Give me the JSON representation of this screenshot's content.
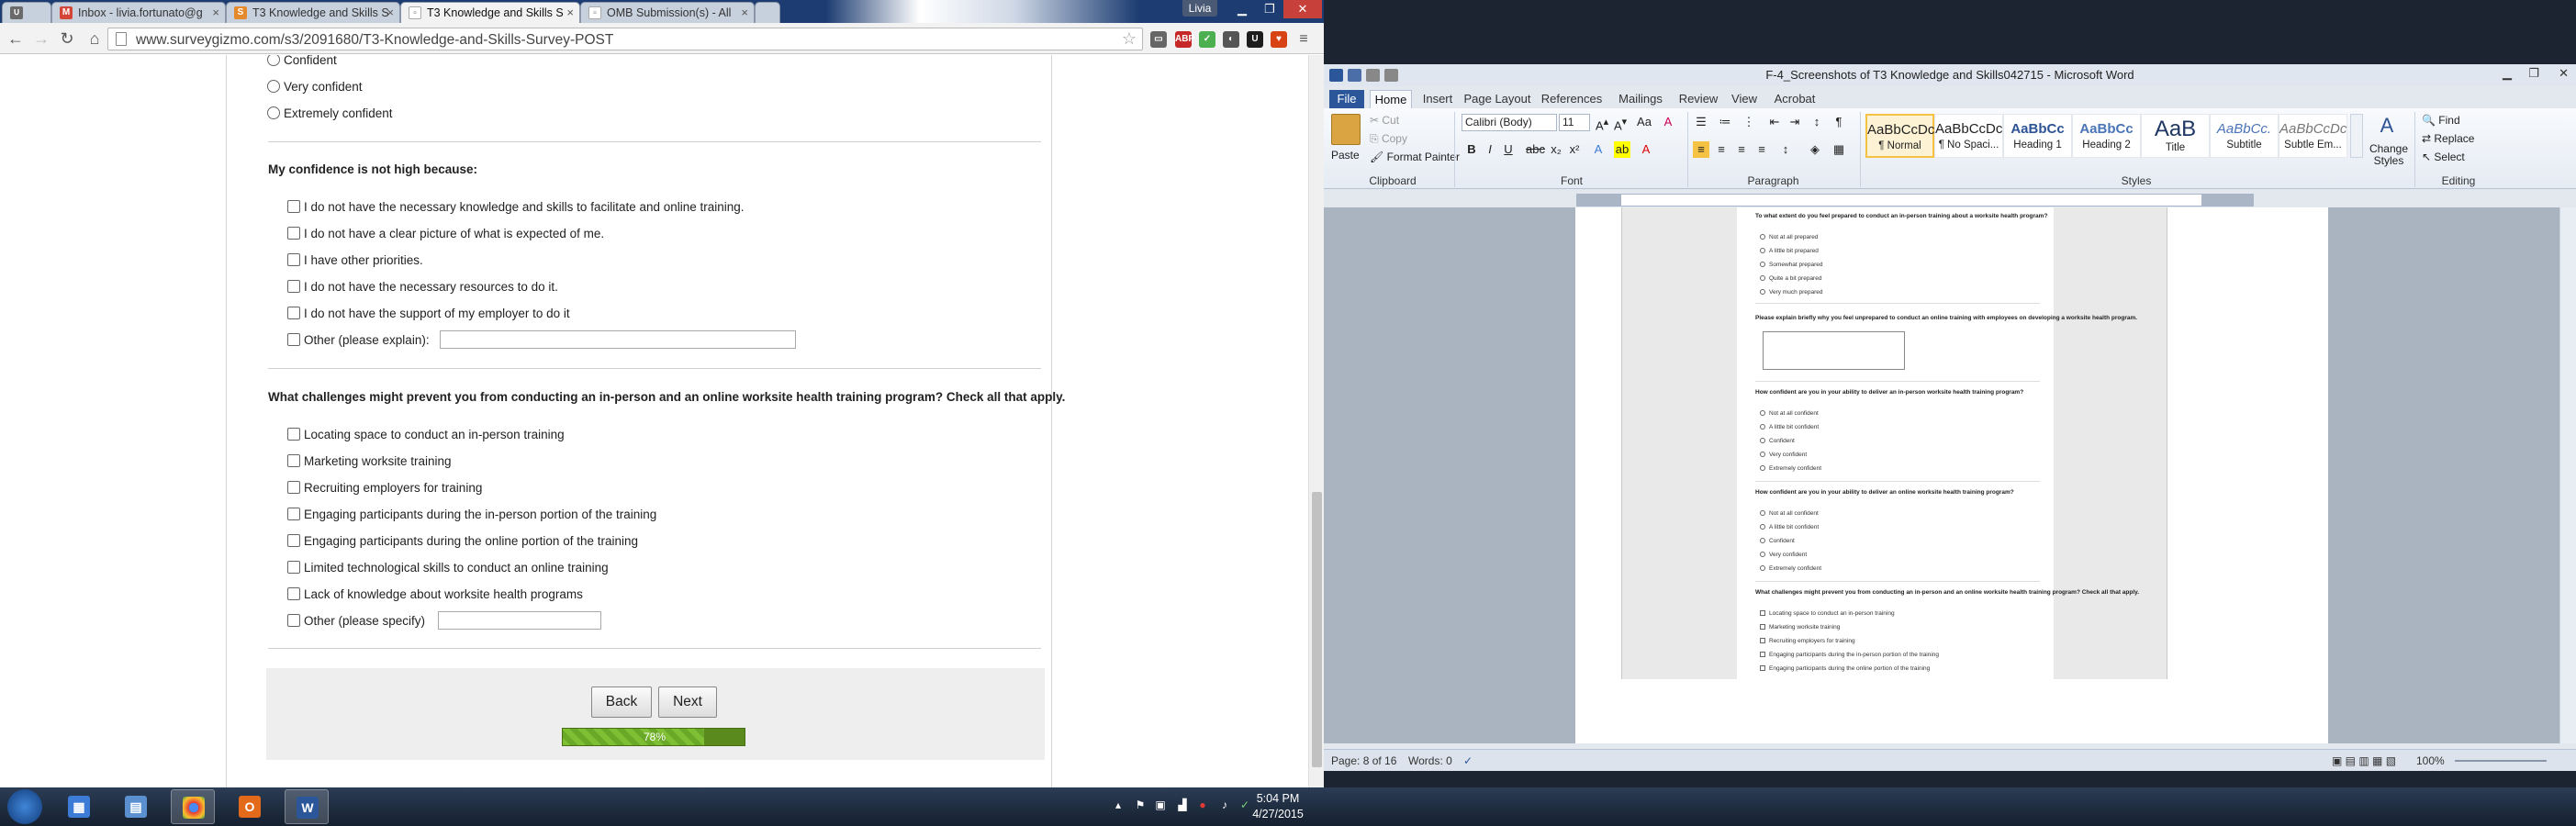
{
  "chrome": {
    "user": "Livia",
    "tabs": [
      {
        "label": "Inbox - livia.fortunato@g",
        "icon": "gmail-icon"
      },
      {
        "label": "T3 Knowledge and Skills S",
        "icon": "surveygizmo-icon"
      },
      {
        "label": "T3 Knowledge and Skills S",
        "icon": "surveygizmo-icon",
        "active": true
      },
      {
        "label": "OMB Submission(s) - All",
        "icon": "document-icon"
      }
    ],
    "url": "www.surveygizmo.com/s3/2091680/T3-Knowledge-and-Skills-Survey-POST"
  },
  "survey": {
    "top_options": [
      "Confident",
      "Very confident",
      "Extremely confident"
    ],
    "q1": {
      "title": "My confidence is not high because:",
      "options": [
        "I do not have the necessary knowledge and skills to facilitate and online training.",
        "I do not have a clear picture of what is expected of me.",
        "I have other priorities.",
        "I do not have the necessary resources to do it.",
        "I do not have the support of my employer to do it",
        "Other (please explain):"
      ]
    },
    "q2": {
      "title": "What challenges might prevent you from conducting an in-person and an online worksite health training program? Check all that apply.",
      "options": [
        "Locating space to conduct an in-person training",
        "Marketing worksite training",
        "Recruiting employers for training",
        "Engaging participants during the in-person portion of the training",
        "Engaging participants during the online portion of the training",
        "Limited technological skills to conduct an online training",
        "Lack of knowledge about worksite health programs",
        "Other (please specify)"
      ]
    },
    "back": "Back",
    "next": "Next",
    "progress_label": "78%",
    "progress": 0.78
  },
  "word": {
    "title": "F-4_Screenshots of T3 Knowledge and Skills042715 - Microsoft Word",
    "tabs": [
      "File",
      "Home",
      "Insert",
      "Page Layout",
      "References",
      "Mailings",
      "Review",
      "View",
      "Acrobat"
    ],
    "clipboard": {
      "paste": "Paste",
      "cut": "Cut",
      "copy": "Copy",
      "format_painter": "Format Painter",
      "label": "Clipboard"
    },
    "font": {
      "name": "Calibri (Body)",
      "size": "11",
      "label": "Font"
    },
    "paragraph_label": "Paragraph",
    "styles": [
      {
        "preview": "AaBbCcDc",
        "name": "¶ Normal",
        "selected": true
      },
      {
        "preview": "AaBbCcDc",
        "name": "¶ No Spaci..."
      },
      {
        "preview": "AaBbCc",
        "name": "Heading 1"
      },
      {
        "preview": "AaBbCc",
        "name": "Heading 2"
      },
      {
        "preview": "AaB",
        "name": "Title"
      },
      {
        "preview": "AaBbCc.",
        "name": "Subtitle"
      },
      {
        "preview": "AaBbCcDc",
        "name": "Subtle Em..."
      }
    ],
    "styles_label": "Styles",
    "change_styles": "Change Styles",
    "editing": {
      "find": "Find",
      "replace": "Replace",
      "select": "Select",
      "label": "Editing"
    },
    "doc": {
      "q1": "To what extent do you feel prepared to conduct an in-person training about a worksite health program?",
      "q1_opts": [
        "Not at all prepared",
        "A little bit prepared",
        "Somewhat prepared",
        "Quite a bit prepared",
        "Very much prepared"
      ],
      "q2": "Please explain briefly why you feel unprepared to conduct an online training with employees on developing a worksite health program.",
      "q3": "How confident are you in your ability to deliver an in-person worksite health training program?",
      "q3_opts": [
        "Not at all confident",
        "A little bit confident",
        "Confident",
        "Very confident",
        "Extremely confident"
      ],
      "q4": "How confident are you in your ability to deliver an online worksite health training program?",
      "q4_opts": [
        "Not at all confident",
        "A little bit confident",
        "Confident",
        "Very confident",
        "Extremely confident"
      ],
      "q5": "What challenges might prevent you from conducting an in-person and an online worksite health training program? Check all that apply.",
      "q5_opts": [
        "Locating space to conduct an in-person training",
        "Marketing worksite training",
        "Recruiting employers for training",
        "Engaging participants during the in-person portion of the training",
        "Engaging participants during the online portion of the training"
      ]
    },
    "status": {
      "page": "Page: 8 of 16",
      "words": "Words: 0",
      "zoom": "100%"
    }
  },
  "taskbar": {
    "apps": [
      "windows-explorer",
      "file-manager",
      "chrome",
      "outlook",
      "word"
    ],
    "time": "5:04 PM",
    "date": "4/27/2015"
  }
}
